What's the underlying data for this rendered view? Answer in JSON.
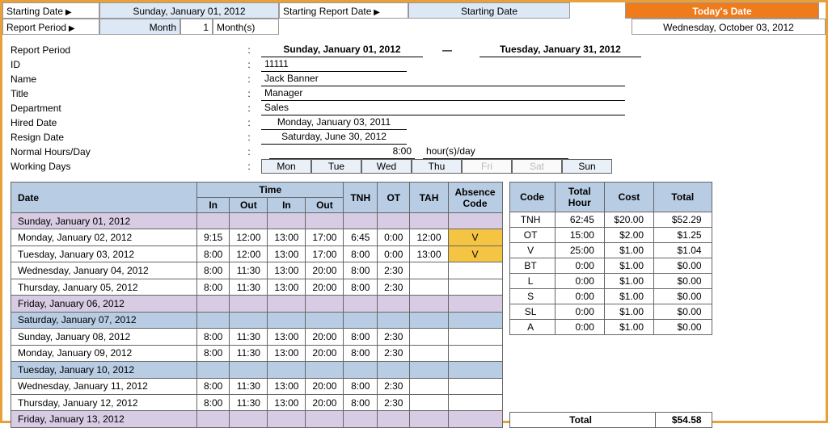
{
  "header": {
    "starting_date_label": "Starting Date",
    "starting_date_value": "Sunday, January 01, 2012",
    "starting_report_label": "Starting Report Date",
    "starting_date2_label": "Starting Date",
    "today_label": "Today's Date",
    "today_value": "Wednesday, October 03, 2012",
    "report_period_label": "Report Period",
    "month_label": "Month",
    "month_value": "1",
    "months_unit": "Month(s)"
  },
  "details": {
    "report_period_label": "Report Period",
    "report_period_start": "Sunday, January 01, 2012",
    "report_period_end": "Tuesday, January 31, 2012",
    "id_label": "ID",
    "id_value": "11111",
    "name_label": "Name",
    "name_value": "Jack Banner",
    "title_label": "Title",
    "title_value": "Manager",
    "department_label": "Department",
    "department_value": "Sales",
    "hired_label": "Hired Date",
    "hired_value": "Monday, January 03, 2011",
    "resign_label": "Resign Date",
    "resign_value": "Saturday, June 30, 2012",
    "hours_label": "Normal Hours/Day",
    "hours_value": "8:00",
    "hours_unit": "hour(s)/day",
    "working_days_label": "Working Days",
    "days": [
      "Mon",
      "Tue",
      "Wed",
      "Thu",
      "Fri",
      "Sat",
      "Sun"
    ],
    "days_off_index": [
      4,
      5
    ]
  },
  "time_headers": {
    "date": "Date",
    "time": "Time",
    "in": "In",
    "out": "Out",
    "tnh": "TNH",
    "ot": "OT",
    "tah": "TAH",
    "absence": "Absence Code"
  },
  "rows": [
    {
      "date": "Sunday, January 01, 2012",
      "weekend": "w1"
    },
    {
      "date": "Monday, January 02, 2012",
      "in1": "9:15",
      "out1": "12:00",
      "in2": "13:00",
      "out2": "17:00",
      "tnh": "6:45",
      "ot": "0:00",
      "tah": "12:00",
      "abs": "V"
    },
    {
      "date": "Tuesday, January 03, 2012",
      "in1": "8:00",
      "out1": "12:00",
      "in2": "13:00",
      "out2": "17:00",
      "tnh": "8:00",
      "ot": "0:00",
      "tah": "13:00",
      "abs": "V"
    },
    {
      "date": "Wednesday, January 04, 2012",
      "in1": "8:00",
      "out1": "11:30",
      "in2": "13:00",
      "out2": "20:00",
      "tnh": "8:00",
      "ot": "2:30",
      "tah": "",
      "abs": ""
    },
    {
      "date": "Thursday, January 05, 2012",
      "in1": "8:00",
      "out1": "11:30",
      "in2": "13:00",
      "out2": "20:00",
      "tnh": "8:00",
      "ot": "2:30",
      "tah": "",
      "abs": ""
    },
    {
      "date": "Friday, January 06, 2012",
      "weekend": "w1"
    },
    {
      "date": "Saturday, January 07, 2012",
      "weekend": "w2"
    },
    {
      "date": "Sunday, January 08, 2012",
      "in1": "8:00",
      "out1": "11:30",
      "in2": "13:00",
      "out2": "20:00",
      "tnh": "8:00",
      "ot": "2:30",
      "tah": "",
      "abs": ""
    },
    {
      "date": "Monday, January 09, 2012",
      "in1": "8:00",
      "out1": "11:30",
      "in2": "13:00",
      "out2": "20:00",
      "tnh": "8:00",
      "ot": "2:30",
      "tah": "",
      "abs": ""
    },
    {
      "date": "Tuesday, January 10, 2012",
      "weekend": "w2"
    },
    {
      "date": "Wednesday, January 11, 2012",
      "in1": "8:00",
      "out1": "11:30",
      "in2": "13:00",
      "out2": "20:00",
      "tnh": "8:00",
      "ot": "2:30",
      "tah": "",
      "abs": ""
    },
    {
      "date": "Thursday, January 12, 2012",
      "in1": "8:00",
      "out1": "11:30",
      "in2": "13:00",
      "out2": "20:00",
      "tnh": "8:00",
      "ot": "2:30",
      "tah": "",
      "abs": ""
    },
    {
      "date": "Friday, January 13, 2012",
      "weekend": "w1"
    }
  ],
  "summary_headers": {
    "code": "Code",
    "total_hour": "Total Hour",
    "cost": "Cost",
    "total": "Total"
  },
  "summary": [
    {
      "code": "TNH",
      "hour": "62:45",
      "cost": "$20.00",
      "total": "$52.29"
    },
    {
      "code": "OT",
      "hour": "15:00",
      "cost": "$2.00",
      "total": "$1.25"
    },
    {
      "code": "V",
      "hour": "25:00",
      "cost": "$1.00",
      "total": "$1.04"
    },
    {
      "code": "BT",
      "hour": "0:00",
      "cost": "$1.00",
      "total": "$0.00"
    },
    {
      "code": "L",
      "hour": "0:00",
      "cost": "$1.00",
      "total": "$0.00"
    },
    {
      "code": "S",
      "hour": "0:00",
      "cost": "$1.00",
      "total": "$0.00"
    },
    {
      "code": "SL",
      "hour": "0:00",
      "cost": "$1.00",
      "total": "$0.00"
    },
    {
      "code": "A",
      "hour": "0:00",
      "cost": "$1.00",
      "total": "$0.00"
    }
  ],
  "grand_total_label": "Total",
  "grand_total_value": "$54.58"
}
